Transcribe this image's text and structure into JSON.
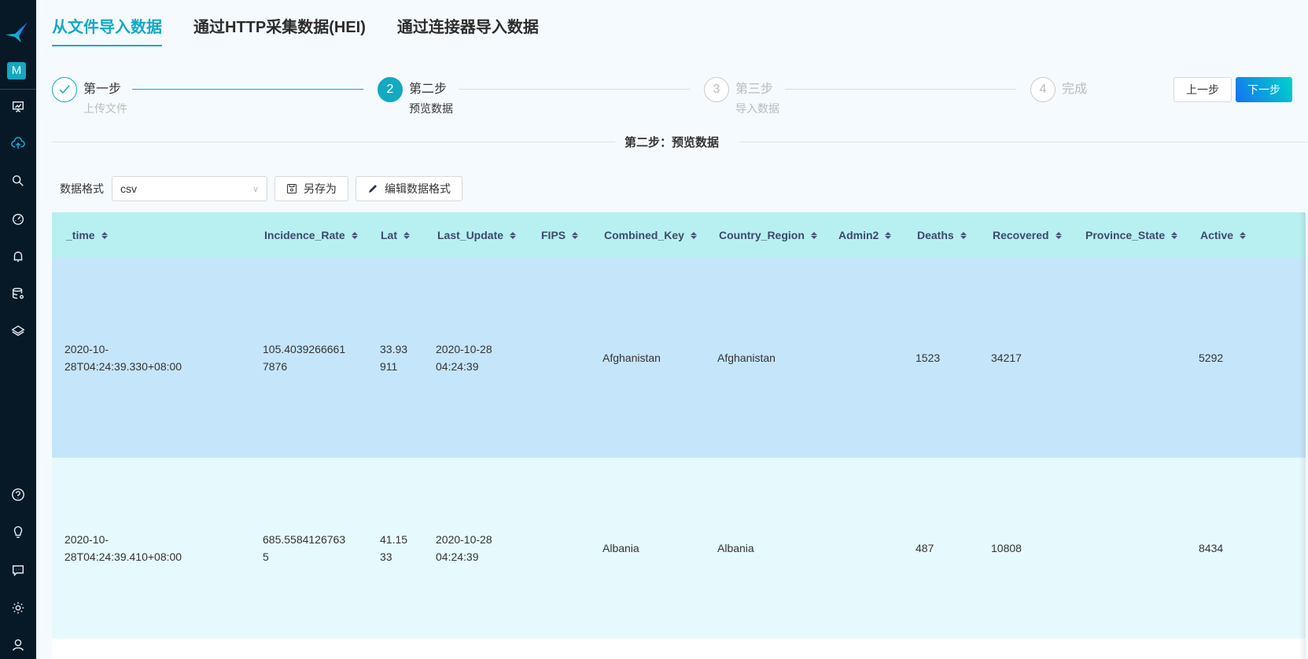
{
  "sidebar": {
    "logo_icon": "bird-logo-icon",
    "workspace_badge": "M",
    "items": [
      {
        "name": "dashboard",
        "icon": "presentation-chart-icon",
        "active": false
      },
      {
        "name": "data-import",
        "icon": "cloud-upload-icon",
        "active": true
      },
      {
        "name": "search",
        "icon": "search-icon",
        "active": false
      },
      {
        "name": "monitor",
        "icon": "gauge-icon",
        "active": false
      },
      {
        "name": "alerts",
        "icon": "bell-icon",
        "active": false
      },
      {
        "name": "database-settings",
        "icon": "database-gear-icon",
        "active": false
      },
      {
        "name": "layers",
        "icon": "layers-icon",
        "active": false
      }
    ],
    "bottom_items": [
      {
        "name": "help",
        "icon": "question-circle-icon"
      },
      {
        "name": "tips",
        "icon": "lightbulb-icon"
      },
      {
        "name": "messages",
        "icon": "chat-icon"
      },
      {
        "name": "settings",
        "icon": "gear-icon"
      },
      {
        "name": "user",
        "icon": "user-icon"
      }
    ]
  },
  "tabs": [
    {
      "label": "从文件导入数据",
      "active": true
    },
    {
      "label": "通过HTTP采集数据(HEI)",
      "active": false
    },
    {
      "label": "通过连接器导入数据",
      "active": false
    }
  ],
  "steps": [
    {
      "number": "1",
      "title": "第一步",
      "desc": "上传文件",
      "status": "done"
    },
    {
      "number": "2",
      "title": "第二步",
      "desc": "预览数据",
      "status": "current"
    },
    {
      "number": "3",
      "title": "第三步",
      "desc": "导入数据",
      "status": "wait"
    },
    {
      "number": "4",
      "title": "完成",
      "desc": "",
      "status": "wait"
    }
  ],
  "buttons": {
    "prev": "上一步",
    "next": "下一步"
  },
  "section_title": "第二步：预览数据",
  "toolbar": {
    "format_label": "数据格式",
    "format_value": "csv",
    "save_as": "另存为",
    "edit_format": "编辑数据格式"
  },
  "accent_color": "#13a9c2",
  "table": {
    "columns": [
      "_time",
      "Incidence_Rate",
      "Lat",
      "Last_Update",
      "FIPS",
      "Combined_Key",
      "Country_Region",
      "Admin2",
      "Deaths",
      "Recovered",
      "Province_State",
      "Active"
    ],
    "rows": [
      {
        "_time": [
          "2020-10-",
          "28T04:24:39.330+08:00"
        ],
        "Incidence_Rate": [
          "105.4039266661",
          "7876"
        ],
        "Lat": [
          "33.93",
          "911"
        ],
        "Last_Update": [
          "2020-10-28",
          "04:24:39"
        ],
        "FIPS": "",
        "Combined_Key": "Afghanistan",
        "Country_Region": "Afghanistan",
        "Admin2": "",
        "Deaths": "1523",
        "Recovered": "34217",
        "Province_State": "",
        "Active": "5292"
      },
      {
        "_time": [
          "2020-10-",
          "28T04:24:39.410+08:00"
        ],
        "Incidence_Rate": [
          "685.5584126763",
          "5"
        ],
        "Lat": [
          "41.15",
          "33"
        ],
        "Last_Update": [
          "2020-10-28",
          "04:24:39"
        ],
        "FIPS": "",
        "Combined_Key": "Albania",
        "Country_Region": "Albania",
        "Admin2": "",
        "Deaths": "487",
        "Recovered": "10808",
        "Province_State": "",
        "Active": "8434"
      }
    ]
  }
}
